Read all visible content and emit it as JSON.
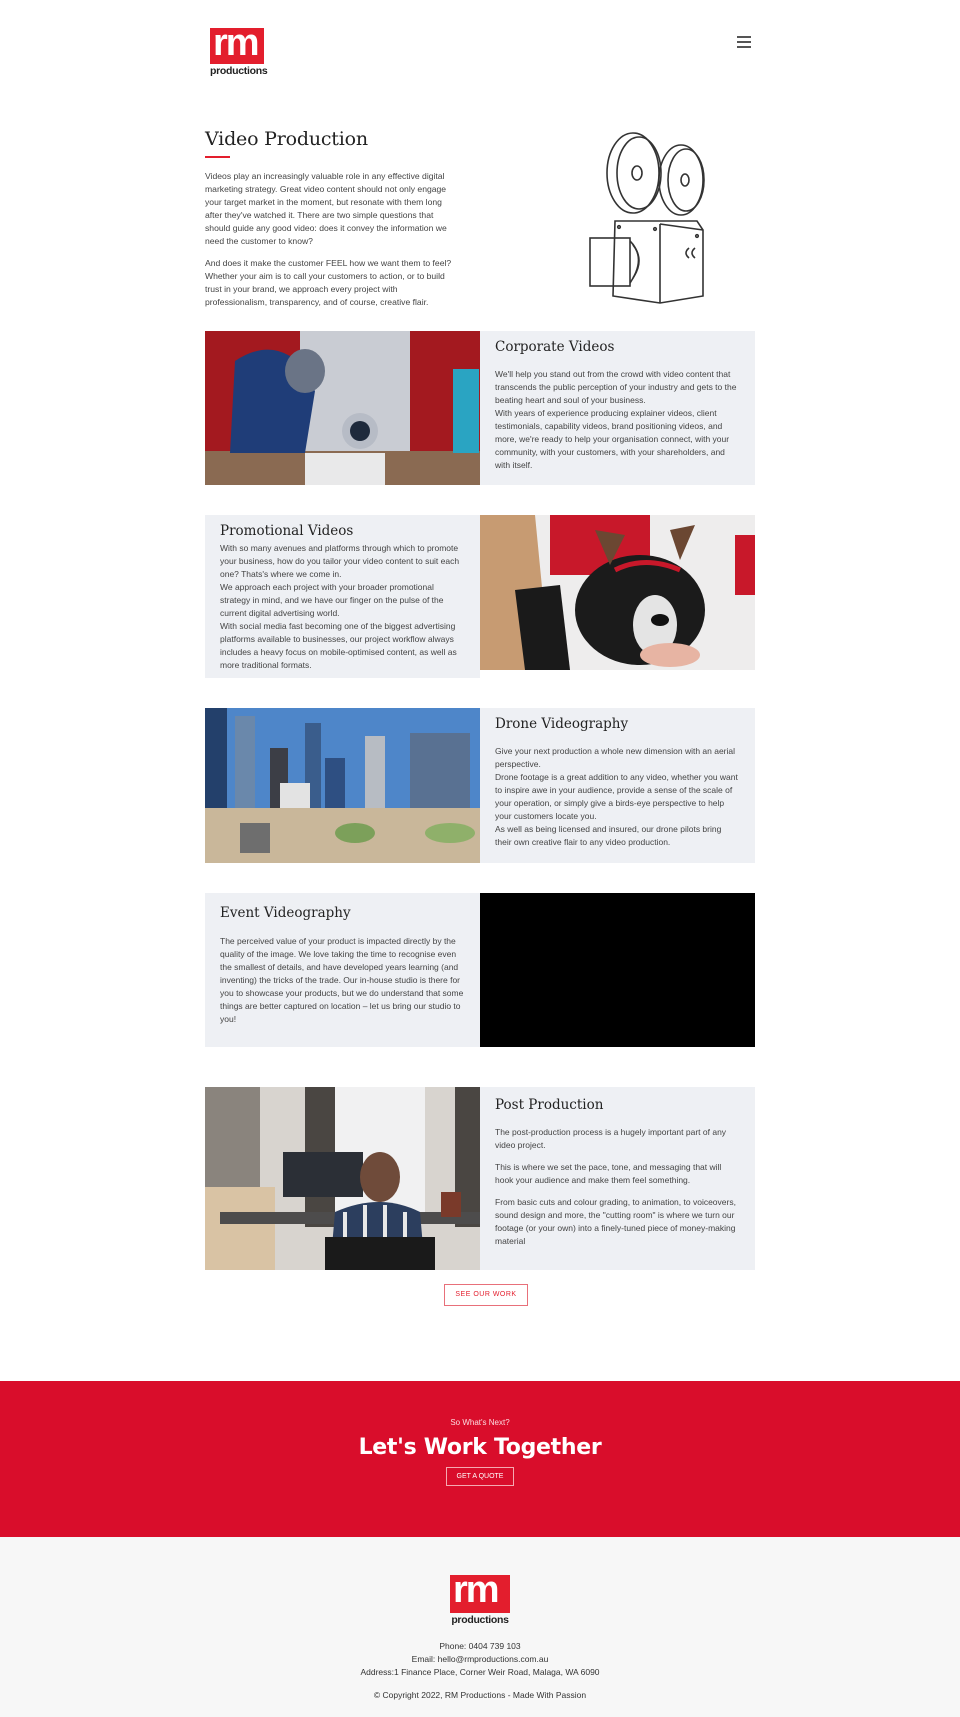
{
  "brand": {
    "logo_text": "rm",
    "logo_sub": "productions",
    "accent": "#e31e2d",
    "cta_bg": "#d90d2b"
  },
  "header": {
    "menu_icon": "hamburger-icon"
  },
  "intro": {
    "title": "Video Production",
    "paragraphs": [
      "Videos play an increasingly valuable role in any effective digital marketing strategy. Great video content should not only engage your target market in the moment, but resonate with them long after they've watched it. There are two simple questions that should guide any good video: does it convey the information we need the customer to know?",
      "And does it make the customer FEEL how we want them to feel? Whether your aim is to call your customers to action, or to build trust in your brand, we approach every project with professionalism, transparency, and of course, creative flair."
    ],
    "illustration": "film-camera-illustration"
  },
  "services": [
    {
      "title": "Corporate Videos",
      "image": "welder-photo",
      "paragraphs": [
        "We'll help you stand out from the crowd with video content that transcends the public perception of your industry and gets to the beating heart and soul of your business.",
        "With years of experience producing explainer videos, client testimonials, capability videos, brand positioning videos, and more, we're ready to help your organisation connect, with your community, with your customers, with your shareholders, and with itself."
      ]
    },
    {
      "title": "Promotional Videos",
      "image": "dog-with-antlers-photo",
      "paragraphs": [
        "With so many avenues and platforms through which to promote your business, how do you tailor your video content to suit each one? Thats's where we come in.",
        "We approach each project with your broader promotional strategy in mind, and we have our finger on the pulse of the current digital advertising world.",
        "With social media fast becoming one of the biggest advertising platforms available to businesses, our project workflow always includes a heavy focus on mobile-optimised content, as well as more traditional formats."
      ]
    },
    {
      "title": "Drone Videography",
      "image": "city-skyline-photo",
      "paragraphs": [
        "Give your next production a whole new dimension with an aerial perspective.",
        "Drone footage is a great addition to any video, whether you want to inspire awe in your audience, provide a sense of the scale of your operation, or simply give a birds-eye perspective to help your customers locate you.",
        "As well as being licensed and insured, our drone pilots bring their own creative flair to any video production."
      ]
    },
    {
      "title": "Event Videography",
      "image": "video-player",
      "paragraphs": [
        "The perceived value of your product is impacted directly by the quality of the image. We love taking the time to recognise even the smallest of details, and have developed years learning (and inventing) the tricks of the trade. Our in-house studio is there for you to showcase your products, but we do understand that some things are better captured on location – let us bring our studio to you!"
      ]
    },
    {
      "title": "Post Production",
      "image": "video-editor-photo",
      "paragraphs": [
        "The post-production process is a hugely important part of any video project.",
        "This is where we set the pace, tone, and messaging that will hook your audience and make them feel something.",
        "From basic cuts and colour grading, to animation, to voiceovers, sound design and more, the \"cutting room\" is where we turn our footage (or your own) into a finely-tuned piece of money-making material"
      ]
    }
  ],
  "see_work_label": "SEE OUR WORK",
  "cta": {
    "pre": "So What's Next?",
    "title": "Let's Work Together",
    "button": "GET A QUOTE"
  },
  "footer": {
    "phone": "Phone: 0404 739 103",
    "email": "Email: hello@rmproductions.com.au",
    "address": "Address:1 Finance Place, Corner Weir Road, Malaga, WA 6090",
    "copyright": "© Copyright 2022, RM Productions - Made With Passion"
  }
}
